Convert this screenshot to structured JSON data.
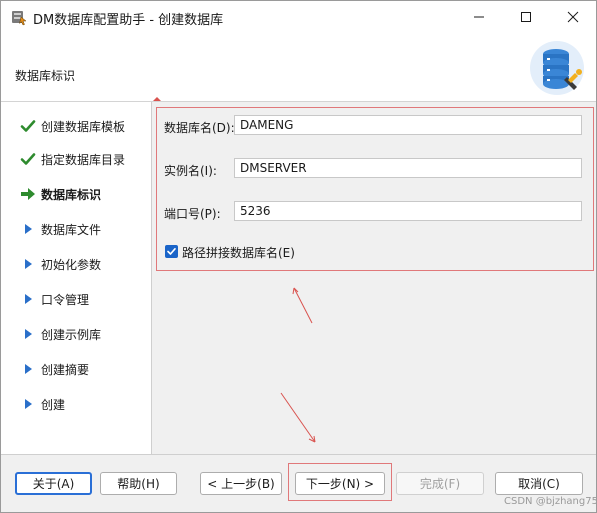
{
  "window": {
    "title": "DM数据库配置助手 - 创建数据库",
    "controls": [
      "minimize-icon",
      "maximize-icon",
      "close-icon"
    ]
  },
  "header": {
    "title": "数据库标识",
    "logo_icon": "database-settings-icon"
  },
  "nav": {
    "items": [
      {
        "label": "创建数据库模板",
        "state": "done",
        "icon": "check-icon"
      },
      {
        "label": "指定数据库目录",
        "state": "done",
        "icon": "check-icon"
      },
      {
        "label": "数据库标识",
        "state": "current",
        "icon": "arrow-right-icon"
      },
      {
        "label": "数据库文件",
        "state": "pending",
        "icon": "triangle-right-icon"
      },
      {
        "label": "初始化参数",
        "state": "pending",
        "icon": "triangle-right-icon"
      },
      {
        "label": "口令管理",
        "state": "pending",
        "icon": "triangle-right-icon"
      },
      {
        "label": "创建示例库",
        "state": "pending",
        "icon": "triangle-right-icon"
      },
      {
        "label": "创建摘要",
        "state": "pending",
        "icon": "triangle-right-icon"
      },
      {
        "label": "创建",
        "state": "pending",
        "icon": "triangle-right-icon"
      }
    ]
  },
  "form": {
    "db_name": {
      "label": "数据库名(D):",
      "value": "DAMENG"
    },
    "instance_name": {
      "label": "实例名(I):",
      "value": "DMSERVER"
    },
    "port": {
      "label": "端口号(P):",
      "value": "5236"
    },
    "path_concat": {
      "label": "路径拼接数据库名(E)",
      "checked": true
    }
  },
  "buttons": {
    "about": "关于(A)",
    "help": "帮助(H)",
    "prev": "< 上一步(B)",
    "next": "下一步(N) >",
    "finish": "完成(F)",
    "cancel": "取消(C)"
  },
  "watermark": "CSDN @bjzhang75",
  "colors": {
    "accent_blue": "#2a6fd6",
    "check_green": "#2e8b2e",
    "annotation_red": "#e0787a",
    "nav_triangle": "#2a6fc9"
  }
}
